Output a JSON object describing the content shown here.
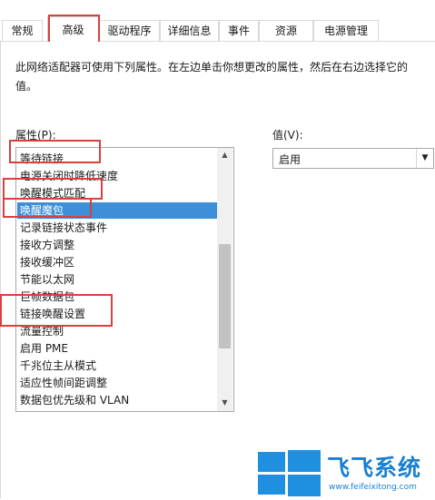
{
  "tabs": [
    {
      "label": "常规"
    },
    {
      "label": "高级"
    },
    {
      "label": "驱动程序"
    },
    {
      "label": "详细信息"
    },
    {
      "label": "事件"
    },
    {
      "label": "资源"
    },
    {
      "label": "电源管理"
    }
  ],
  "active_tab": "高级",
  "description": "此网络适配器可使用下列属性。在左边单击你想更改的属性，然后在右边选择它的值。",
  "property_label": "属性(P):",
  "value_label": "值(V):",
  "properties": [
    "等待链接",
    "电源关闭时降低速度",
    "唤醒模式匹配",
    "唤醒魔包",
    "记录链接状态事件",
    "接收方调整",
    "接收缓冲区",
    "节能以太网",
    "巨帧数据包",
    "链接唤醒设置",
    "流量控制",
    "启用 PME",
    "千兆位主从模式",
    "适应性帧间距调整",
    "数据包优先级和 VLAN"
  ],
  "selected_property": "唤醒魔包",
  "value_selected": "启用",
  "scroll_up_icon": "arrow-up-icon",
  "scroll_down_icon": "arrow-down-icon",
  "dropdown_icon": "chevron-down-icon",
  "highlight_color": "#d9413f",
  "selection_color": "#3d8fd8",
  "watermark": {
    "brand": "飞飞系统",
    "url": "www.feifeixitong.com"
  }
}
